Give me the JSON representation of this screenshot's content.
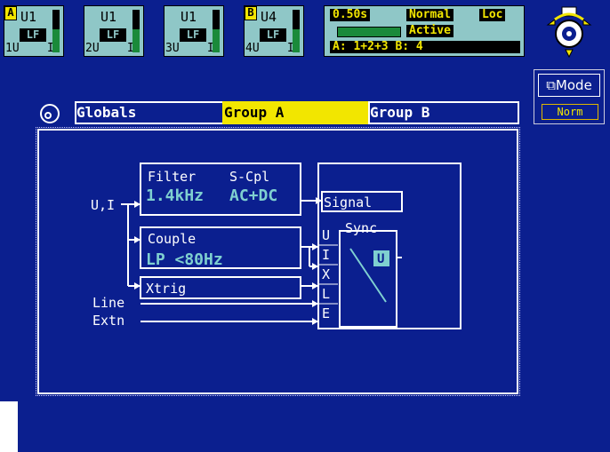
{
  "channels": [
    {
      "num": "1U",
      "name": "U1",
      "lf": "LF",
      "io": "I",
      "level": 0.55
    },
    {
      "num": "2U",
      "name": "U1",
      "lf": "LF",
      "io": "I",
      "level": 0.55
    },
    {
      "num": "3U",
      "name": "U1",
      "lf": "LF",
      "io": "I",
      "level": 0.55
    },
    {
      "num": "4U",
      "name": "U4",
      "lf": "LF",
      "io": "I",
      "level": 0.55
    }
  ],
  "group_markers": {
    "a": "A",
    "b": "B"
  },
  "status": {
    "cycle": "0.50s",
    "mode": "Normal",
    "lock": "Loc",
    "state": "Active",
    "groups": "A: 1+2+3  B: 4",
    "progress": 0.45
  },
  "mode_button": {
    "label": "Mode",
    "value": "Norm"
  },
  "tabs": {
    "globals": "Globals",
    "group_a": "Group A",
    "group_b": "Group B"
  },
  "diagram": {
    "filter": {
      "title": "Filter",
      "scpl": "S-Cpl",
      "value": "1.4kHz",
      "coupling": "AC+DC"
    },
    "couple": {
      "title": "Couple",
      "value": "LP <80Hz"
    },
    "xtrig": "Xtrig",
    "signal": "Signal",
    "sync": "Sync",
    "sync_badge": "U",
    "sync_inputs": [
      "U",
      "I",
      "X",
      "L",
      "E"
    ],
    "inputs": {
      "ui": "U,I",
      "line": "Line",
      "extn": "Extn"
    }
  },
  "colors": {
    "background": "#0b1f8f",
    "highlight": "#f2e600",
    "diagram_value": "#7fd0d0",
    "panel": "#8fc7c7"
  }
}
